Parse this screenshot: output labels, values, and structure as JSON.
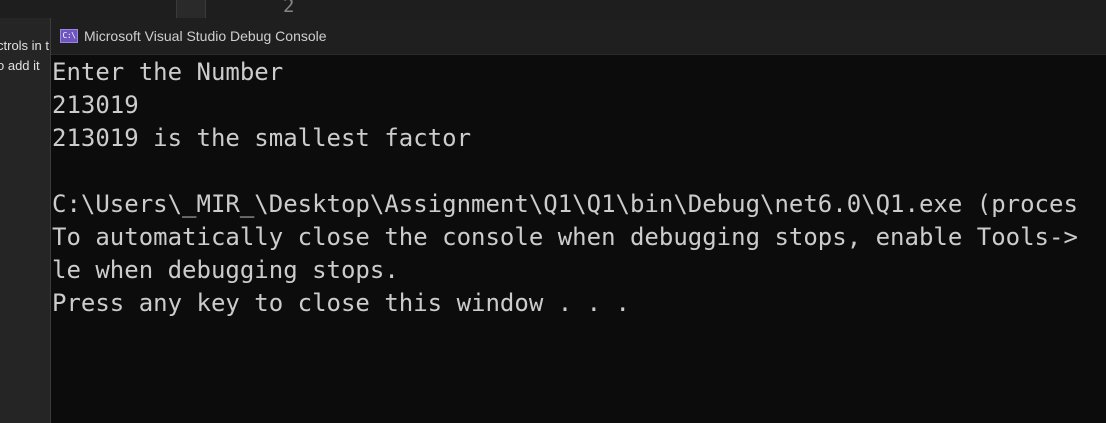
{
  "background": {
    "line_number": "2",
    "side_text_1": "ctrols in t",
    "side_text_2": "o add it"
  },
  "window": {
    "title": "Microsoft Visual Studio Debug Console",
    "icon": "console-app-icon",
    "icon_glyph": "C:\\"
  },
  "console": {
    "lines": [
      "Enter the Number",
      "213019",
      "213019 is the smallest factor",
      "",
      "C:\\Users\\_MIR_\\Desktop\\Assignment\\Q1\\Q1\\bin\\Debug\\net6.0\\Q1.exe (proces",
      "To automatically close the console when debugging stops, enable Tools->",
      "le when debugging stops.",
      "Press any key to close this window . . ."
    ]
  },
  "colors": {
    "console_background": "#0c0c0c",
    "console_text": "#cccccc",
    "title_bar": "#1f1f1f",
    "icon_accent": "#6f55c2"
  }
}
